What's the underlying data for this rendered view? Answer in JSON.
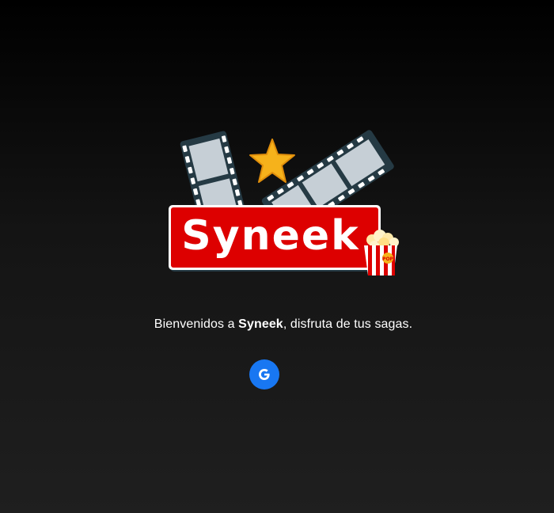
{
  "logo": {
    "brand_text": "Syneek",
    "popcorn_label": "POP"
  },
  "welcome": {
    "prefix": "Bienvenidos a ",
    "brand": "Syneek",
    "suffix": ", disfruta de tus sagas."
  },
  "google_button": {
    "icon": "google-icon",
    "color": "#1877f2"
  },
  "colors": {
    "banner_red": "#dd0000",
    "film_dark": "#253a44",
    "film_light": "#c6cfd6",
    "star": "#f6b21b"
  }
}
